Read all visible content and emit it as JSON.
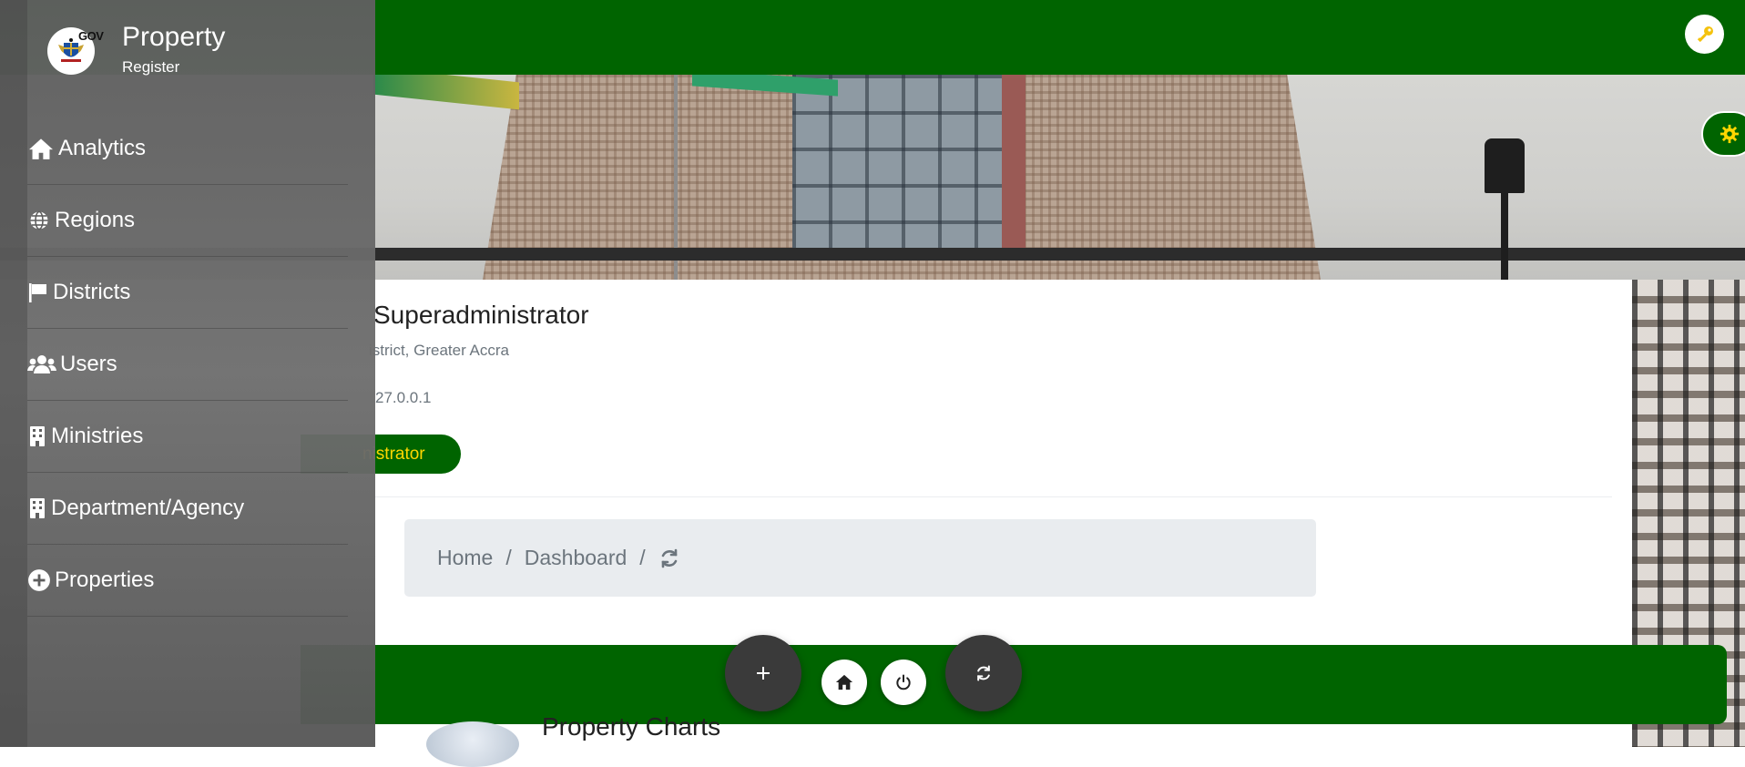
{
  "app": {
    "title": "Property",
    "subtitle": "Register",
    "logo_badge": "GOV",
    "icons": {
      "logo": "coat-of-arms-icon",
      "key": "key-icon",
      "settings": "gear-icon"
    }
  },
  "sidebar": {
    "items": [
      {
        "label": "Analytics",
        "icon": "home-icon"
      },
      {
        "label": "Regions",
        "icon": "globe-icon"
      },
      {
        "label": "Districts",
        "icon": "flag-icon"
      },
      {
        "label": "Users",
        "icon": "users-icon"
      },
      {
        "label": "Ministries",
        "icon": "building-icon"
      },
      {
        "label": "Department/Agency",
        "icon": "building-icon"
      },
      {
        "label": "Properties",
        "icon": "plus-circle-icon"
      }
    ]
  },
  "profile": {
    "name": "Superadministrator",
    "location": "istrict, Greater Accra",
    "ip": "27.0.0.1",
    "role": "nistrator"
  },
  "breadcrumb": {
    "items": [
      "Home",
      "Dashboard"
    ],
    "separator": "/",
    "refresh_icon": "refresh-icon"
  },
  "section": {
    "title": "Property Charts"
  },
  "actions": {
    "add_icon": "plus-icon",
    "home_icon": "home-icon",
    "power_icon": "power-icon",
    "refresh_icon": "refresh-icon"
  },
  "colors": {
    "primary_green": "#006400",
    "accent_yellow": "#ffd700",
    "sidebar_gray": "#5f5f5f",
    "fab_dark": "#3a3a3a",
    "breadcrumb_bg": "#e9ecef"
  }
}
